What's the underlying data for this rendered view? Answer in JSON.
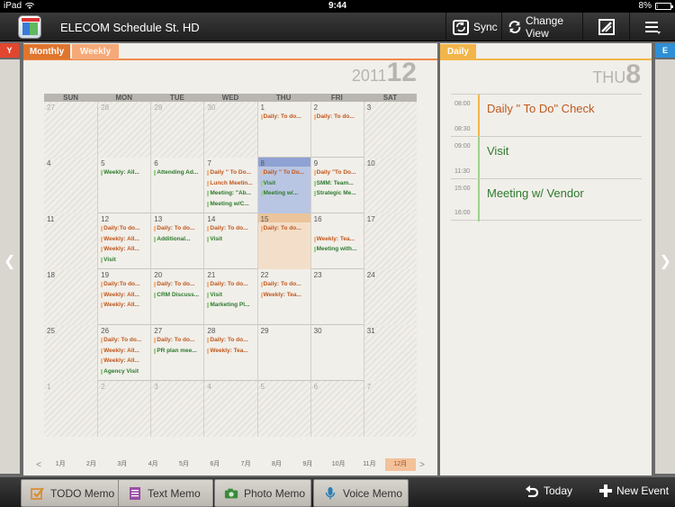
{
  "status": {
    "device": "iPad",
    "time": "9:44",
    "battery": "8%",
    "battery_level": 0.08
  },
  "toolbar": {
    "title": "ELECOM Schedule St. HD",
    "sync": "Sync",
    "change_view": "Change View"
  },
  "side": {
    "left_tab": "Y",
    "right_tab": "E"
  },
  "calendar": {
    "tab_monthly": "Monthly",
    "tab_weekly": "Weekly",
    "year": "2011",
    "month": "12",
    "weekdays": [
      "SUN",
      "MON",
      "TUE",
      "WED",
      "THU",
      "FRI",
      "SAT"
    ],
    "weeks": [
      [
        {
          "d": "27",
          "other": true,
          "ev": []
        },
        {
          "d": "28",
          "other": true,
          "ev": []
        },
        {
          "d": "29",
          "other": true,
          "ev": []
        },
        {
          "d": "30",
          "other": true,
          "ev": []
        },
        {
          "d": "1",
          "ev": [
            {
              "t": "Daily: To do...",
              "c": "o"
            }
          ]
        },
        {
          "d": "2",
          "ev": [
            {
              "t": "Daily: To do...",
              "c": "o"
            }
          ]
        },
        {
          "d": "3",
          "weekend": true,
          "ev": []
        }
      ],
      [
        {
          "d": "4",
          "weekend": true,
          "ev": []
        },
        {
          "d": "5",
          "ev": [
            {
              "t": "Weekly: All...",
              "c": "g"
            }
          ]
        },
        {
          "d": "6",
          "ev": [
            {
              "t": "Attending Ad...",
              "c": "g"
            }
          ]
        },
        {
          "d": "7",
          "ev": [
            {
              "t": "Daily \" To Do...",
              "c": "o"
            },
            {
              "t": "Lunch Meetin...",
              "c": "o"
            },
            {
              "t": "Meeting: \"Ab...",
              "c": "g"
            },
            {
              "t": "Meeting w/C...",
              "c": "g"
            }
          ]
        },
        {
          "d": "8",
          "today": true,
          "ev": [
            {
              "t": "Daily \" To Do...",
              "c": "o"
            },
            {
              "t": "Visit",
              "c": "g"
            },
            {
              "t": "Meeting w/...",
              "c": "g"
            }
          ]
        },
        {
          "d": "9",
          "ev": [
            {
              "t": "Daily \"To Do...",
              "c": "o"
            },
            {
              "t": "SMM: Team...",
              "c": "g"
            },
            {
              "t": "Strategic Me...",
              "c": "g"
            }
          ]
        },
        {
          "d": "10",
          "weekend": true,
          "ev": []
        }
      ],
      [
        {
          "d": "11",
          "weekend": true,
          "ev": []
        },
        {
          "d": "12",
          "ev": [
            {
              "t": "Daily:To do...",
              "c": "o"
            },
            {
              "t": "Weekly: All...",
              "c": "o"
            },
            {
              "t": "Weekly: All...",
              "c": "o"
            },
            {
              "t": "Visit",
              "c": "g"
            }
          ]
        },
        {
          "d": "13",
          "ev": [
            {
              "t": "Daily: To do...",
              "c": "o"
            },
            {
              "t": "Additional...",
              "c": "g"
            }
          ]
        },
        {
          "d": "14",
          "ev": [
            {
              "t": "Daily: To do...",
              "c": "o"
            },
            {
              "t": "Visit",
              "c": "g"
            }
          ]
        },
        {
          "d": "15",
          "sel": true,
          "ev": [
            {
              "t": "Daily: To do...",
              "c": "o"
            }
          ]
        },
        {
          "d": "16",
          "ev": [
            {
              "t": "",
              "c": "o"
            },
            {
              "t": "Weekly: Tea...",
              "c": "o"
            },
            {
              "t": "Meeting with...",
              "c": "g"
            }
          ]
        },
        {
          "d": "17",
          "weekend": true,
          "ev": []
        }
      ],
      [
        {
          "d": "18",
          "weekend": true,
          "ev": []
        },
        {
          "d": "19",
          "ev": [
            {
              "t": "Daily:To do...",
              "c": "o"
            },
            {
              "t": "Weekly: All...",
              "c": "o"
            },
            {
              "t": "Weekly: All...",
              "c": "o"
            }
          ]
        },
        {
          "d": "20",
          "ev": [
            {
              "t": "Daily: To do...",
              "c": "o"
            },
            {
              "t": "CRM Discuss...",
              "c": "g"
            }
          ]
        },
        {
          "d": "21",
          "ev": [
            {
              "t": "Daily: To do...",
              "c": "o"
            },
            {
              "t": "Visit",
              "c": "g"
            },
            {
              "t": "Marketing Pl...",
              "c": "g"
            }
          ]
        },
        {
          "d": "22",
          "ev": [
            {
              "t": "Daily: To do...",
              "c": "o"
            },
            {
              "t": "Weekly: Tea...",
              "c": "o"
            }
          ]
        },
        {
          "d": "23",
          "ev": []
        },
        {
          "d": "24",
          "weekend": true,
          "ev": []
        }
      ],
      [
        {
          "d": "25",
          "weekend": true,
          "ev": []
        },
        {
          "d": "26",
          "ev": [
            {
              "t": "Daily: To do...",
              "c": "o"
            },
            {
              "t": "Weekly: All...",
              "c": "o"
            },
            {
              "t": "Weekly: All...",
              "c": "o"
            },
            {
              "t": "Agency Visit",
              "c": "g"
            }
          ]
        },
        {
          "d": "27",
          "ev": [
            {
              "t": "Daily: To do...",
              "c": "o"
            },
            {
              "t": "PR plan mee...",
              "c": "g"
            }
          ]
        },
        {
          "d": "28",
          "ev": [
            {
              "t": "Daily: To do...",
              "c": "o"
            },
            {
              "t": "Weekly: Tea...",
              "c": "o"
            }
          ]
        },
        {
          "d": "29",
          "ev": []
        },
        {
          "d": "30",
          "ev": []
        },
        {
          "d": "31",
          "weekend": true,
          "ev": []
        }
      ],
      [
        {
          "d": "1",
          "other": true,
          "ev": []
        },
        {
          "d": "2",
          "other": true,
          "ev": []
        },
        {
          "d": "3",
          "other": true,
          "ev": []
        },
        {
          "d": "4",
          "other": true,
          "ev": []
        },
        {
          "d": "5",
          "other": true,
          "ev": []
        },
        {
          "d": "6",
          "other": true,
          "ev": []
        },
        {
          "d": "7",
          "other": true,
          "ev": []
        }
      ]
    ],
    "months": [
      "1月",
      "2月",
      "3月",
      "4月",
      "5月",
      "6月",
      "7月",
      "8月",
      "9月",
      "10月",
      "11月",
      "12月"
    ],
    "active_month": "12月",
    "prev": "<",
    "next": ">"
  },
  "daily": {
    "tab": "Daily",
    "weekday": "THU",
    "day": "8",
    "entries": [
      {
        "start": "08:00",
        "end": "08:30",
        "title": "Daily \" To Do\" Check",
        "color": "#c0581e",
        "bar": "#f2b54a"
      },
      {
        "start": "09:00",
        "end": "11:30",
        "title": "Visit",
        "color": "#2d7a2d",
        "bar": "#9fd08a"
      },
      {
        "start": "15:00",
        "end": "16:00",
        "title": "Meeting w/ Vendor",
        "color": "#2d7a2d",
        "bar": "#9fd08a"
      }
    ]
  },
  "bottom": {
    "todo": "TODO Memo",
    "text": "Text Memo",
    "photo": "Photo Memo",
    "voice": "Voice Memo",
    "today": "Today",
    "new_event": "New Event"
  }
}
